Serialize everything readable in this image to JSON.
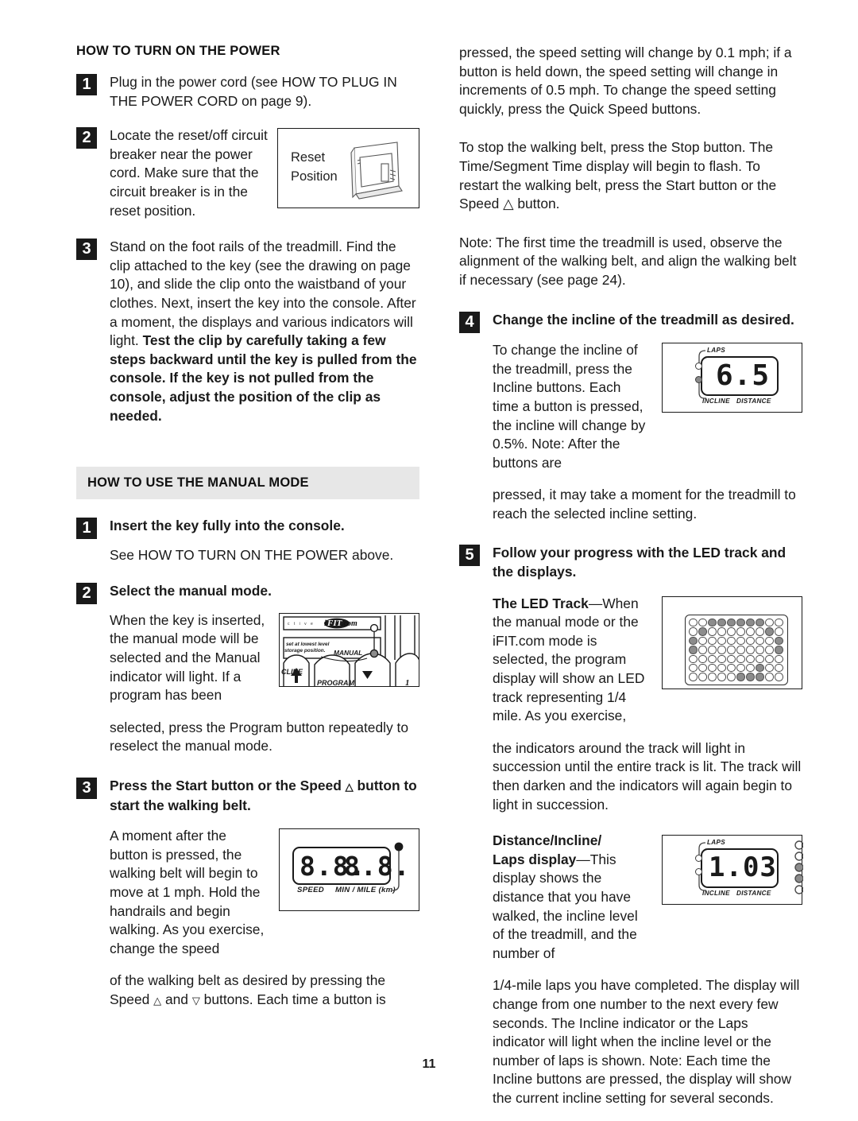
{
  "page": {
    "number": "11"
  },
  "left_column": {
    "section1": {
      "heading": "HOW TO TURN ON THE POWER",
      "steps": [
        {
          "num": "1",
          "paragraphs": [
            {
              "text": "Plug in the power cord (see HOW TO PLUG IN THE POWER CORD on page 9).",
              "bold": false
            }
          ]
        },
        {
          "num": "2",
          "paragraphs": [
            {
              "text": "Locate the reset/off circuit breaker near the power cord. Make sure that the circuit breaker is in the reset position.",
              "bold": false
            }
          ],
          "figure": {
            "name": "reset-position-figure",
            "label_line1": "Reset",
            "label_line2": "Position"
          }
        },
        {
          "num": "3",
          "paragraphs": [
            {
              "text": "Stand on the foot rails of the treadmill. Find the clip attached to the key (see the drawing on page 10), and slide the clip onto the waistband of your clothes. Next, insert the key into the console. After a moment, the displays and various indicators will light. ",
              "bold": false
            },
            {
              "text": "Test the clip by carefully taking a few steps backward until the key is pulled from the console. If the key is not pulled from the console, adjust the position of the clip as needed.",
              "bold": true
            }
          ]
        }
      ]
    },
    "section2": {
      "heading": "HOW TO USE THE MANUAL MODE",
      "steps": [
        {
          "num": "1",
          "title": "Insert the key fully into the console.",
          "body": "See HOW TO TURN ON THE POWER above."
        },
        {
          "num": "2",
          "title": "Select the manual mode.",
          "body_part1": "When the key is inserted, the manual mode will be selected and the Manual indicator will light. If a program has been",
          "body_part2": "selected, press the Program button repeatedly to reselect the manual mode.",
          "figure": {
            "name": "console-figure",
            "brand_prefix": "c t i v e",
            "brand": "iFIT.com",
            "note_line1": "set at lowest level",
            "note_line2": "storage position.",
            "manual_label": "MANUAL",
            "incline_label": "CLINE",
            "program_label": "PROGRAM",
            "number_label": "1"
          }
        },
        {
          "num": "3",
          "title_part1": "Press the Start button or the Speed ",
          "title_sym": "△",
          "title_part2": " button to start the walking belt.",
          "body_part1": "A moment after the button is pressed, the walking belt will begin to move at 1 mph. Hold the handrails and begin walking. As you exercise, change the speed",
          "body_part2a": "of the walking belt as desired by pressing the Speed ",
          "body_part2b": " and ",
          "body_part2c": " buttons. Each time a button is",
          "figure": {
            "name": "speed-display-figure",
            "digits_left": "8.8.",
            "digits_right": "8.8.",
            "label_speed": "SPEED",
            "label_units": "MIN / MILE (km)"
          }
        }
      ]
    }
  },
  "right_column": {
    "continuation_paragraphs": [
      "pressed, the speed setting will change by 0.1 mph; if a button is held down, the speed setting will change in increments of 0.5 mph. To change the speed setting quickly, press the Quick Speed buttons.",
      "To stop the walking belt, press the Stop button. The Time/Segment Time display will begin to flash. To restart the walking belt, press the Start button or the Speed △ button.",
      "Note: The first time the treadmill is used, observe the alignment of the walking belt, and align the walking belt if necessary (see page 24)."
    ],
    "steps": [
      {
        "num": "4",
        "title": "Change the incline of the treadmill as desired.",
        "body_part1": "To change the incline of the treadmill, press the Incline buttons. Each time a button is pressed, the incline will change by 0.5%. Note: After the buttons are",
        "body_part2": "pressed, it may take a moment for the treadmill to reach the selected incline setting.",
        "figure": {
          "name": "incline-display-figure",
          "digits": "6.5",
          "label_laps": "LAPS",
          "label_incline": "INCLINE",
          "label_distance": "DISTANCE"
        }
      },
      {
        "num": "5",
        "title": "Follow your progress with the LED track and the displays.",
        "sub1_bold": "The LED Track",
        "sub1_dash": "—",
        "sub1_part1": "When the manual mode or the iFIT.com mode is selected, the program display will show an LED track representing 1/4 mile. As you exercise,",
        "sub1_part2": "the indicators around the track will light in succession until the entire track is lit. The track will then darken and the indicators will again begin to light in succession.",
        "figure_track": {
          "name": "led-track-figure",
          "rows": 7,
          "cols": 10,
          "lit": [
            [
              0,
              0,
              1,
              1,
              1,
              1,
              1,
              1,
              0,
              0
            ],
            [
              0,
              1,
              0,
              0,
              0,
              0,
              0,
              0,
              1,
              0
            ],
            [
              1,
              0,
              0,
              0,
              0,
              0,
              0,
              0,
              0,
              1
            ],
            [
              1,
              0,
              0,
              0,
              0,
              0,
              0,
              0,
              0,
              1
            ],
            [
              0,
              0,
              0,
              0,
              0,
              0,
              0,
              0,
              0,
              0
            ],
            [
              0,
              0,
              0,
              0,
              0,
              0,
              0,
              1,
              0,
              0
            ],
            [
              0,
              0,
              0,
              0,
              0,
              1,
              1,
              1,
              0,
              0
            ]
          ]
        },
        "sub2_bold1": "Distance/Incline/",
        "sub2_bold2": "Laps display",
        "sub2_dash": "—",
        "sub2_part1": "This display shows the distance that you have walked, the incline level of the treadmill, and the number of",
        "sub2_part2": "1/4-mile laps you have completed. The display will change from one number to the next every few seconds. The Incline indicator or the Laps indicator will light when the incline level or the number of laps is shown. Note: Each time the Incline buttons are pressed, the display will show the current incline setting for several seconds.",
        "figure_laps": {
          "name": "laps-display-figure",
          "digits": "1.03",
          "label_laps": "LAPS",
          "label_incline": "INCLINE",
          "label_distance": "DISTANCE"
        }
      }
    ]
  }
}
